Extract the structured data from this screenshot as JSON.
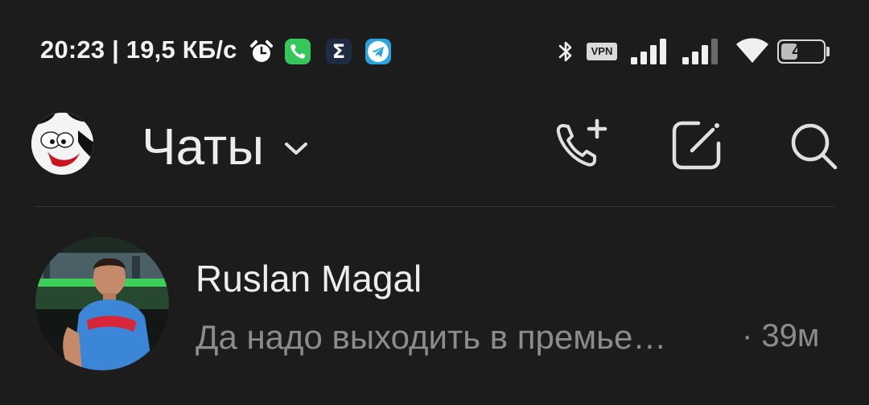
{
  "status_bar": {
    "time_speed": "20:23 | 19,5 КБ/с",
    "icons": [
      "alarm-icon",
      "phone-app-icon",
      "sigma-app-icon",
      "telegram-app-icon",
      "bluetooth-icon",
      "vpn-badge",
      "signal-icon",
      "signal-icon",
      "wifi-icon",
      "battery-icon"
    ],
    "sigma_glyph": "Σ",
    "vpn_label": "VPN",
    "battery_level": "40",
    "battery_fraction": 0.4
  },
  "header": {
    "title": "Чаты",
    "icons": [
      "avatar",
      "chevron-down-icon",
      "new-call-icon",
      "compose-icon",
      "search-icon"
    ]
  },
  "chats": [
    {
      "name": "Ruslan Magal",
      "preview": "Да надо выходить в премье…",
      "time": "· 39м"
    }
  ],
  "colors": {
    "background": "#1c1c1c",
    "primary_text": "#ededed",
    "secondary_text": "#8c8c8c",
    "divider": "#363636"
  }
}
